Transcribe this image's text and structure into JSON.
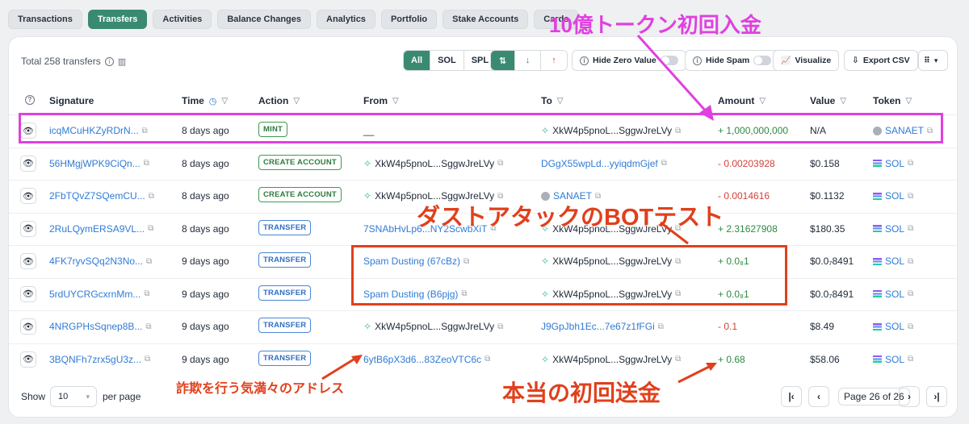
{
  "tabs": [
    "Transactions",
    "Transfers",
    "Activities",
    "Balance Changes",
    "Analytics",
    "Portfolio",
    "Stake Accounts",
    "Cards"
  ],
  "toolbar": {
    "total": "Total 258 transfers",
    "filter_all": "All",
    "filter_sol": "SOL",
    "filter_spl": "SPL",
    "hide_zero": "Hide Zero Value",
    "hide_spam": "Hide Spam",
    "visualize": "Visualize",
    "export": "Export CSV"
  },
  "columns": {
    "signature": "Signature",
    "time": "Time",
    "action": "Action",
    "from": "From",
    "to": "To",
    "amount": "Amount",
    "value": "Value",
    "token": "Token"
  },
  "rows": [
    {
      "sig": "icqMCuHKZyRDrN...",
      "time": "8 days ago",
      "action": "MINT",
      "from": "__",
      "to": "XkW4p5pnoL...SggwJreLVy",
      "amount": "+ 1,000,000,000",
      "value": "N/A",
      "token": "SANAET"
    },
    {
      "sig": "56HMgjWPK9CiQn...",
      "time": "8 days ago",
      "action": "CREATE ACCOUNT",
      "from": "XkW4p5pnoL...SggwJreLVy",
      "to": "DGgX55wpLd...yyiqdmGjef",
      "amount": "- 0.00203928",
      "value": "$0.158",
      "token": "SOL"
    },
    {
      "sig": "2FbTQvZ7SQemCU...",
      "time": "8 days ago",
      "action": "CREATE ACCOUNT",
      "from": "XkW4p5pnoL...SggwJreLVy",
      "to": "SANAET",
      "amount": "- 0.0014616",
      "value": "$0.1132",
      "token": "SOL"
    },
    {
      "sig": "2RuLQymERSA9VL...",
      "time": "8 days ago",
      "action": "TRANSFER",
      "from": "7SNAbHvLp6...NY2ScwbXiT",
      "to": "XkW4p5pnoL...SggwJreLVy",
      "amount": "+ 2.31627908",
      "value": "$180.35",
      "token": "SOL"
    },
    {
      "sig": "4FK7ryvSQq2N3No...",
      "time": "9 days ago",
      "action": "TRANSFER",
      "from": "Spam Dusting (67cBz)",
      "to": "XkW4p5pnoL...SggwJreLVy",
      "amount": "+ 0.0₈1",
      "value": "$0.0₇8491",
      "token": "SOL"
    },
    {
      "sig": "5rdUYCRGcxrnMm...",
      "time": "9 days ago",
      "action": "TRANSFER",
      "from": "Spam Dusting (B6pjg)",
      "to": "XkW4p5pnoL...SggwJreLVy",
      "amount": "+ 0.0₈1",
      "value": "$0.0₇8491",
      "token": "SOL"
    },
    {
      "sig": "4NRGPHsSqnep8B...",
      "time": "9 days ago",
      "action": "TRANSFER",
      "from": "XkW4p5pnoL...SggwJreLVy",
      "to": "J9GpJbh1Ec...7e67z1fFGi",
      "amount": "- 0.1",
      "value": "$8.49",
      "token": "SOL"
    },
    {
      "sig": "3BQNFh7zrx5gU3z...",
      "time": "9 days ago",
      "action": "TRANSFER",
      "from": "6ytB6pX3d6...83ZeoVTC6c",
      "to": "XkW4p5pnoL...SggwJreLVy",
      "amount": "+ 0.68",
      "value": "$58.06",
      "token": "SOL"
    }
  ],
  "footer": {
    "show": "Show",
    "per_page_value": "10",
    "per_page": "per page",
    "page_label": "Page 26 of 26"
  },
  "annotations": {
    "first_deposit": "10億トークン初回入金",
    "dust_bot": "ダストアタックのBOTテスト",
    "scam_address": "詐欺を行う気満々のアドレス",
    "real_first": "本当の初回送金"
  },
  "colors": {
    "accent": "#3a8a72",
    "magenta": "#e040e0",
    "red_annotation": "#e0401c",
    "link": "#2f7bd6"
  }
}
